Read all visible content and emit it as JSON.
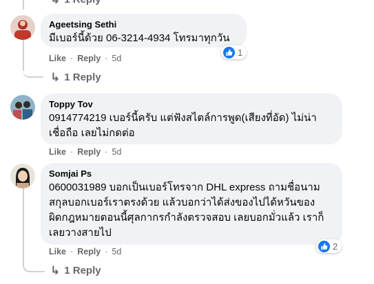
{
  "top_reply": {
    "label": "1 Reply"
  },
  "comments": [
    {
      "author": "Ageetsing Sethi",
      "text": "มีเบอร์นี้ด้วย 06-3214-4934 โทรมาทุกวัน",
      "like_label": "Like",
      "reply_label": "Reply",
      "time": "5d",
      "reaction_count": "1",
      "replies_label": "1 Reply",
      "avatar_color": "#c0392b"
    },
    {
      "author": "Toppy Tov",
      "text": "0914774219 เบอร์นี้ครับ แต่ฟังสไตล์การพูด(เสียงที่อัด) ไม่น่า\nเชื่อถือ เลยไม่กดต่อ",
      "like_label": "Like",
      "reply_label": "Reply",
      "time": "5d",
      "avatar_color": "#3b6e8f"
    },
    {
      "author": "Somjai Ps",
      "text": "0600031989 บอกเป็นเบอร์โทรจาก DHL express ถามชื่อนาม\nสกุลบอกเบอร์เราตรงด้วย แล้วบอกว่าได้ส่งของไปได้หวันของ\nผิดกฎหมายตอนนี้ศุลกากรกำลังตรวจสอบ เลยบอกมั่วแล้ว เราก็\nเลยวางสายไป",
      "like_label": "Like",
      "reply_label": "Reply",
      "time": "5d",
      "reaction_count": "2",
      "replies_label": "1 Reply",
      "avatar_color": "#d9c9a8"
    }
  ],
  "separator": "·"
}
